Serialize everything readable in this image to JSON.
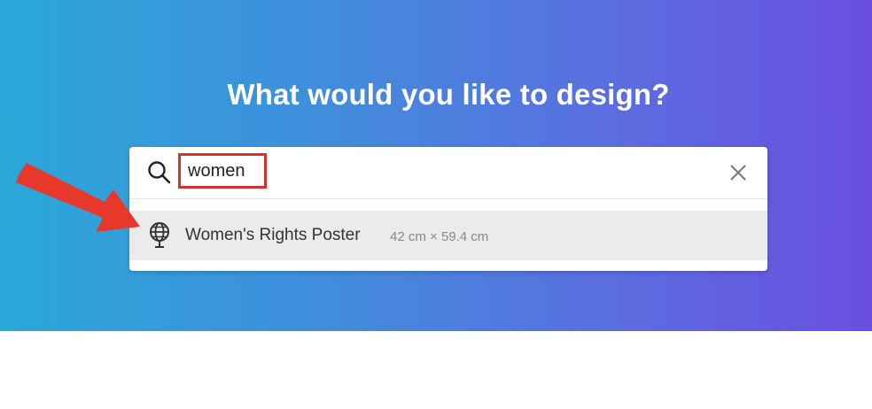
{
  "headline": "What would you like to design?",
  "search": {
    "query": "women",
    "placeholder": ""
  },
  "results": [
    {
      "title": "Women's Rights Poster",
      "dimensions": "42 cm × 59.4 cm",
      "icon": "globe-icon"
    }
  ],
  "colors": {
    "gradient_start": "#2aa8d8",
    "gradient_end": "#6a4fe0",
    "highlight_red": "#d9302b",
    "arrow_red": "#e8382c"
  }
}
